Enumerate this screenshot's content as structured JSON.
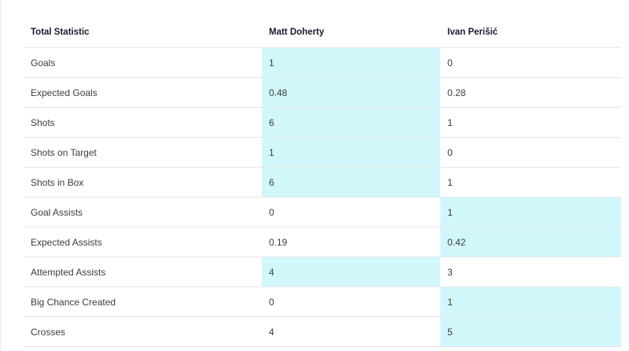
{
  "header": {
    "stat_label": "Total Statistic",
    "player1": "Matt Doherty",
    "player2": "Ivan Perišić"
  },
  "colors": {
    "highlight": "#d2f7fb",
    "border": "#e6e6e6"
  },
  "rows": [
    {
      "stat": "Goals",
      "p1": "1",
      "p2": "0",
      "winner": "p1"
    },
    {
      "stat": "Expected Goals",
      "p1": "0.48",
      "p2": "0.28",
      "winner": "p1"
    },
    {
      "stat": "Shots",
      "p1": "6",
      "p2": "1",
      "winner": "p1"
    },
    {
      "stat": "Shots on Target",
      "p1": "1",
      "p2": "0",
      "winner": "p1"
    },
    {
      "stat": "Shots in Box",
      "p1": "6",
      "p2": "1",
      "winner": "p1"
    },
    {
      "stat": "Goal Assists",
      "p1": "0",
      "p2": "1",
      "winner": "p2"
    },
    {
      "stat": "Expected Assists",
      "p1": "0.19",
      "p2": "0.42",
      "winner": "p2"
    },
    {
      "stat": "Attempted Assists",
      "p1": "4",
      "p2": "3",
      "winner": "p1"
    },
    {
      "stat": "Big Chance Created",
      "p1": "0",
      "p2": "1",
      "winner": "p2"
    },
    {
      "stat": "Crosses",
      "p1": "4",
      "p2": "5",
      "winner": "p2"
    }
  ]
}
